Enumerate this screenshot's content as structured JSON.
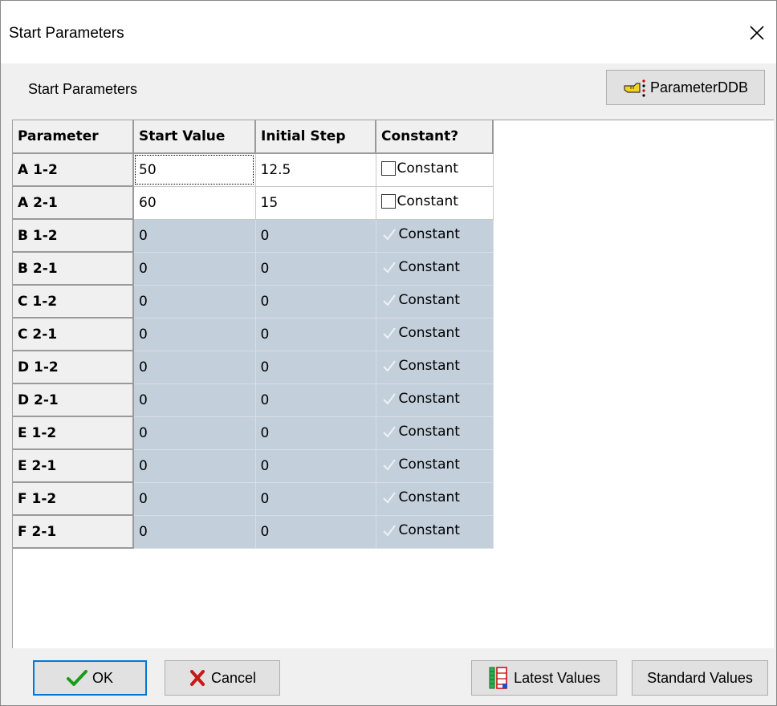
{
  "window": {
    "title": "Start Parameters"
  },
  "header": {
    "section_label": "Start Parameters",
    "ddb_button_label": "ParameterDDB"
  },
  "table": {
    "columns": [
      "Parameter",
      "Start Value",
      "Initial Step",
      "Constant?"
    ],
    "rows": [
      {
        "param": "A 1-2",
        "start": "50",
        "step": "12.5",
        "constant": "Constant"
      },
      {
        "param": "A 2-1",
        "start": "60",
        "step": "15",
        "constant": "Constant"
      },
      {
        "param": "B 1-2",
        "start": "0",
        "step": "0",
        "constant": "Constant"
      },
      {
        "param": "B 2-1",
        "start": "0",
        "step": "0",
        "constant": "Constant"
      },
      {
        "param": "C 1-2",
        "start": "0",
        "step": "0",
        "constant": "Constant"
      },
      {
        "param": "C 2-1",
        "start": "0",
        "step": "0",
        "constant": "Constant"
      },
      {
        "param": "D 1-2",
        "start": "0",
        "step": "0",
        "constant": "Constant"
      },
      {
        "param": "D 2-1",
        "start": "0",
        "step": "0",
        "constant": "Constant"
      },
      {
        "param": "E 1-2",
        "start": "0",
        "step": "0",
        "constant": "Constant"
      },
      {
        "param": "E 2-1",
        "start": "0",
        "step": "0",
        "constant": "Constant"
      },
      {
        "param": "F 1-2",
        "start": "0",
        "step": "0",
        "constant": "Constant"
      },
      {
        "param": "F 2-1",
        "start": "0",
        "step": "0",
        "constant": "Constant"
      }
    ]
  },
  "footer": {
    "ok_label": "OK",
    "cancel_label": "Cancel",
    "latest_label": "Latest Values",
    "standard_label": "Standard Values"
  },
  "icons": {
    "close": "close-icon",
    "ddb": "pointing-hand-icon",
    "ok": "checkmark-icon",
    "cancel": "x-mark-icon",
    "latest": "table-list-icon"
  },
  "colors": {
    "fixed_cell_bg": "#c3cfdb",
    "ok_check": "#1a9c1a",
    "cancel_x": "#c81818",
    "focus_border": "#0078d7"
  }
}
